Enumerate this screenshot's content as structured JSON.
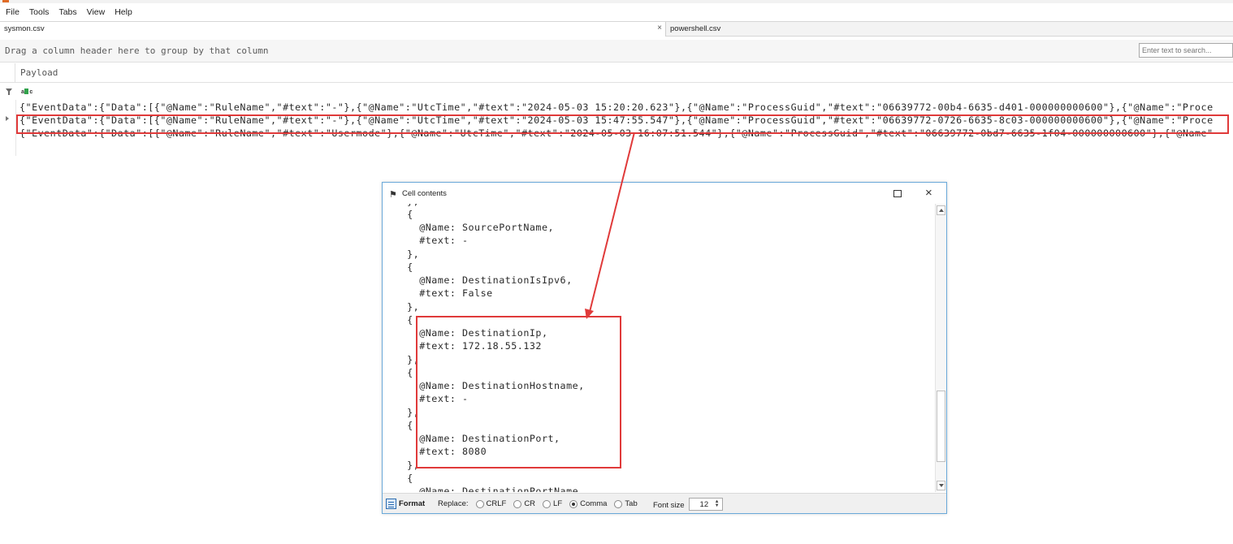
{
  "menu": [
    "File",
    "Tools",
    "Tabs",
    "View",
    "Help"
  ],
  "tabs": [
    {
      "label": "sysmon.csv",
      "close": "×"
    },
    {
      "label": "powershell.csv"
    }
  ],
  "group_hint": "Drag a column header here to group by that column",
  "search": {
    "placeholder": "Enter text to search..."
  },
  "column": {
    "title": "Payload"
  },
  "filter_icon_label": "ABC",
  "rows": [
    "{\"EventData\":{\"Data\":[{\"@Name\":\"RuleName\",\"#text\":\"-\"},{\"@Name\":\"UtcTime\",\"#text\":\"2024-05-03 15:20:20.623\"},{\"@Name\":\"ProcessGuid\",\"#text\":\"06639772-00b4-6635-d401-000000000600\"},{\"@Name\":\"Proce",
    "{\"EventData\":{\"Data\":[{\"@Name\":\"RuleName\",\"#text\":\"-\"},{\"@Name\":\"UtcTime\",\"#text\":\"2024-05-03 15:47:55.547\"},{\"@Name\":\"ProcessGuid\",\"#text\":\"06639772-0726-6635-8c03-000000000600\"},{\"@Name\":\"Proce",
    "{\"EventData\":{\"Data\":[{\"@Name\":\"RuleName\",\"#text\":\"Usermode\"},{\"@Name\":\"UtcTime\",\"#text\":\"2024-05-03 16:07:51.544\"},{\"@Name\":\"ProcessGuid\",\"#text\":\"06639772-0bd7-6635-1f04-000000000600\"},{\"@Name\""
  ],
  "dialog": {
    "title": "Cell contents",
    "icon": "telescope-icon",
    "close": "×",
    "lines": [
      "    },",
      "    {",
      "      @Name: SourcePortName,",
      "      #text: -",
      "    },",
      "    {",
      "      @Name: DestinationIsIpv6,",
      "      #text: False",
      "    },",
      "    {",
      "      @Name: DestinationIp,",
      "      #text: 172.18.55.132",
      "    },",
      "    {",
      "      @Name: DestinationHostname,",
      "      #text: -",
      "    },",
      "    {",
      "      @Name: DestinationPort,",
      "      #text: 8080",
      "    },",
      "    {",
      "      @Name: DestinationPortName"
    ],
    "footer": {
      "format_label": "Format",
      "replace_label": "Replace:",
      "options": [
        {
          "label": "CRLF",
          "selected": false
        },
        {
          "label": "CR",
          "selected": false
        },
        {
          "label": "LF",
          "selected": false
        },
        {
          "label": "Comma",
          "selected": true
        },
        {
          "label": "Tab",
          "selected": false
        }
      ],
      "font_size_label": "Font size",
      "font_size": "12"
    }
  },
  "colors": {
    "highlight": "#e03a3a",
    "dialog_border": "#6aa9d9",
    "accent": "#e06b26"
  }
}
